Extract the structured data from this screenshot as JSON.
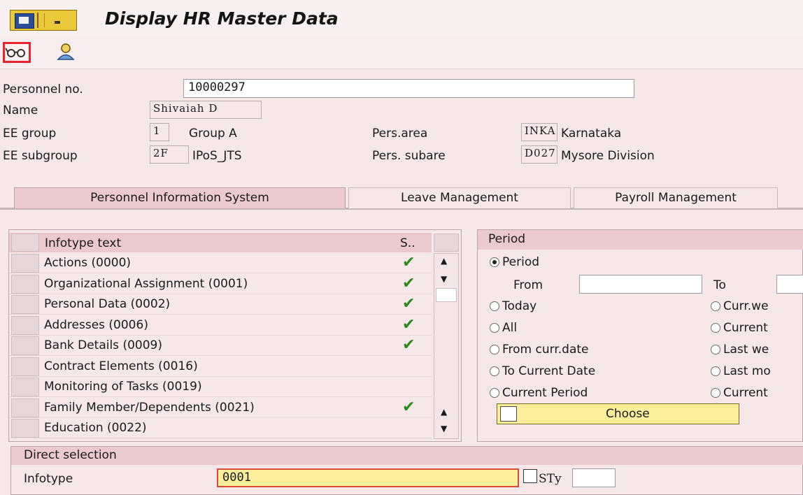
{
  "window": {
    "title": "Display HR Master Data"
  },
  "toolbar": {
    "overview_icon": "glasses-icon",
    "person_icon": "person-icon"
  },
  "header": {
    "personnel_no_label": "Personnel no.",
    "personnel_no_value": "10000297",
    "name_label": "Name",
    "name_value": "Shivaiah D",
    "ee_group_label": "EE group",
    "ee_group_code": "1",
    "ee_group_text": "Group A",
    "ee_subgroup_label": "EE subgroup",
    "ee_subgroup_code": "2F",
    "ee_subgroup_text": "IPoS_JTS",
    "pers_area_label": "Pers.area",
    "pers_area_code": "INKA",
    "pers_area_text": "Karnataka",
    "pers_subarea_label": "Pers. subare",
    "pers_subarea_code": "D027",
    "pers_subarea_text": "Mysore Division"
  },
  "tabs": [
    {
      "label": "Personnel Information System"
    },
    {
      "label": "Leave Management"
    },
    {
      "label": "Payroll Management"
    }
  ],
  "infotypes": {
    "header_text": "Infotype text",
    "header_status": "S..",
    "rows": [
      {
        "text": "Actions (0000)",
        "checked": true
      },
      {
        "text": "Organizational Assignment (0001)",
        "checked": true
      },
      {
        "text": "Personal Data (0002)",
        "checked": true
      },
      {
        "text": "Addresses (0006)",
        "checked": true
      },
      {
        "text": "Bank Details (0009)",
        "checked": true
      },
      {
        "text": "Contract Elements (0016)",
        "checked": false
      },
      {
        "text": "Monitoring of Tasks (0019)",
        "checked": false
      },
      {
        "text": "Family Member/Dependents (0021)",
        "checked": true
      },
      {
        "text": "Education (0022)",
        "checked": false
      }
    ],
    "check_glyph": "✔"
  },
  "period": {
    "title": "Period",
    "period_option": "Period",
    "from_label": "From",
    "to_label": "To",
    "from_value": "",
    "to_value": "",
    "left_options": [
      "Today",
      "All",
      "From curr.date",
      "To Current Date",
      "Current Period"
    ],
    "right_options": [
      "Curr.we",
      "Current",
      "Last we",
      "Last mo",
      "Current"
    ],
    "choose_label": "Choose"
  },
  "direct_selection": {
    "title": "Direct selection",
    "infotype_label": "Infotype",
    "infotype_value": "0001",
    "sty_label": "STy",
    "sty_value": ""
  },
  "colors": {
    "background": "#f6e7e9",
    "accent_red": "#e8232d",
    "button_yellow": "#fbef9b"
  }
}
